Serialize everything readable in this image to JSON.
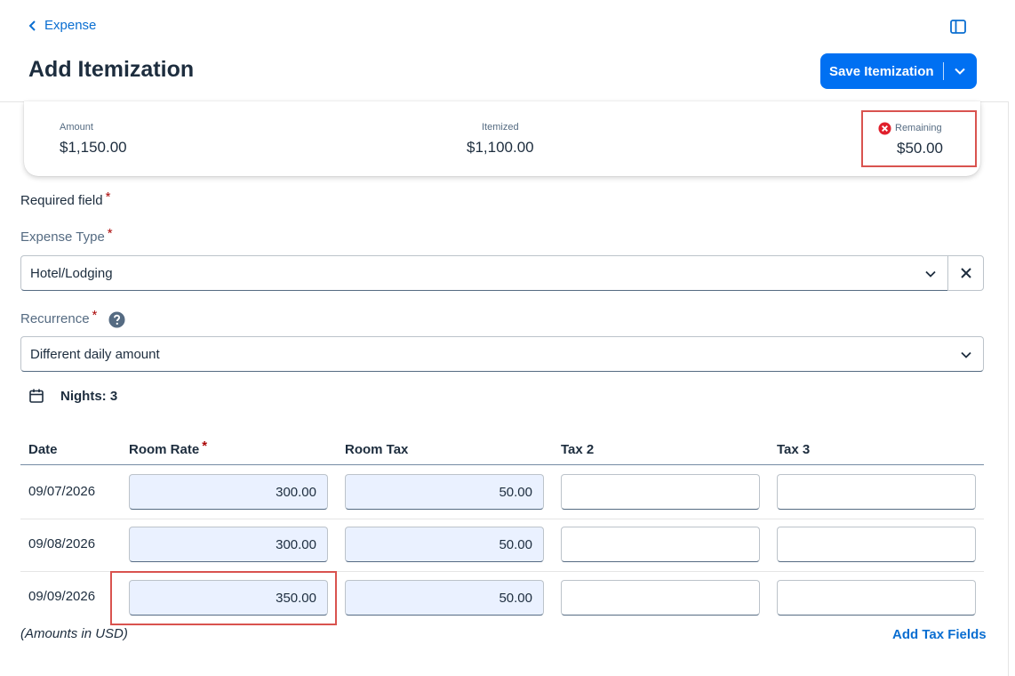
{
  "header": {
    "back_label": "Expense",
    "title": "Add Itemization",
    "save_label": "Save Itemization"
  },
  "summary": {
    "amount_label": "Amount",
    "amount_value": "$1,150.00",
    "itemized_label": "Itemized",
    "itemized_value": "$1,100.00",
    "remaining_label": "Remaining",
    "remaining_value": "$50.00"
  },
  "form": {
    "required_note": "Required field",
    "asterisk": "*",
    "expense_type_label": "Expense Type",
    "expense_type_value": "Hotel/Lodging",
    "recurrence_label": "Recurrence",
    "recurrence_value": "Different daily amount",
    "nights_label": "Nights: 3"
  },
  "table": {
    "headers": [
      "Date",
      "Room Rate",
      "Room Tax",
      "Tax 2",
      "Tax 3"
    ],
    "rows": [
      {
        "date": "09/07/2026",
        "room_rate": "300.00",
        "room_tax": "50.00",
        "tax2": "",
        "tax3": ""
      },
      {
        "date": "09/08/2026",
        "room_rate": "300.00",
        "room_tax": "50.00",
        "tax2": "",
        "tax3": ""
      },
      {
        "date": "09/09/2026",
        "room_rate": "350.00",
        "room_tax": "50.00",
        "tax2": "",
        "tax3": ""
      }
    ]
  },
  "footer": {
    "amounts_note": "(Amounts in USD)",
    "add_tax_label": "Add Tax Fields"
  },
  "colors": {
    "accent": "#0070f2",
    "link": "#0a6ed1",
    "error": "#d9534f",
    "input_filled_bg": "#eaf1ff"
  },
  "icons": [
    "chevron-left-icon",
    "sidebar-toggle-icon",
    "chevron-down-icon",
    "error-icon",
    "close-icon",
    "help-icon",
    "calendar-icon"
  ]
}
